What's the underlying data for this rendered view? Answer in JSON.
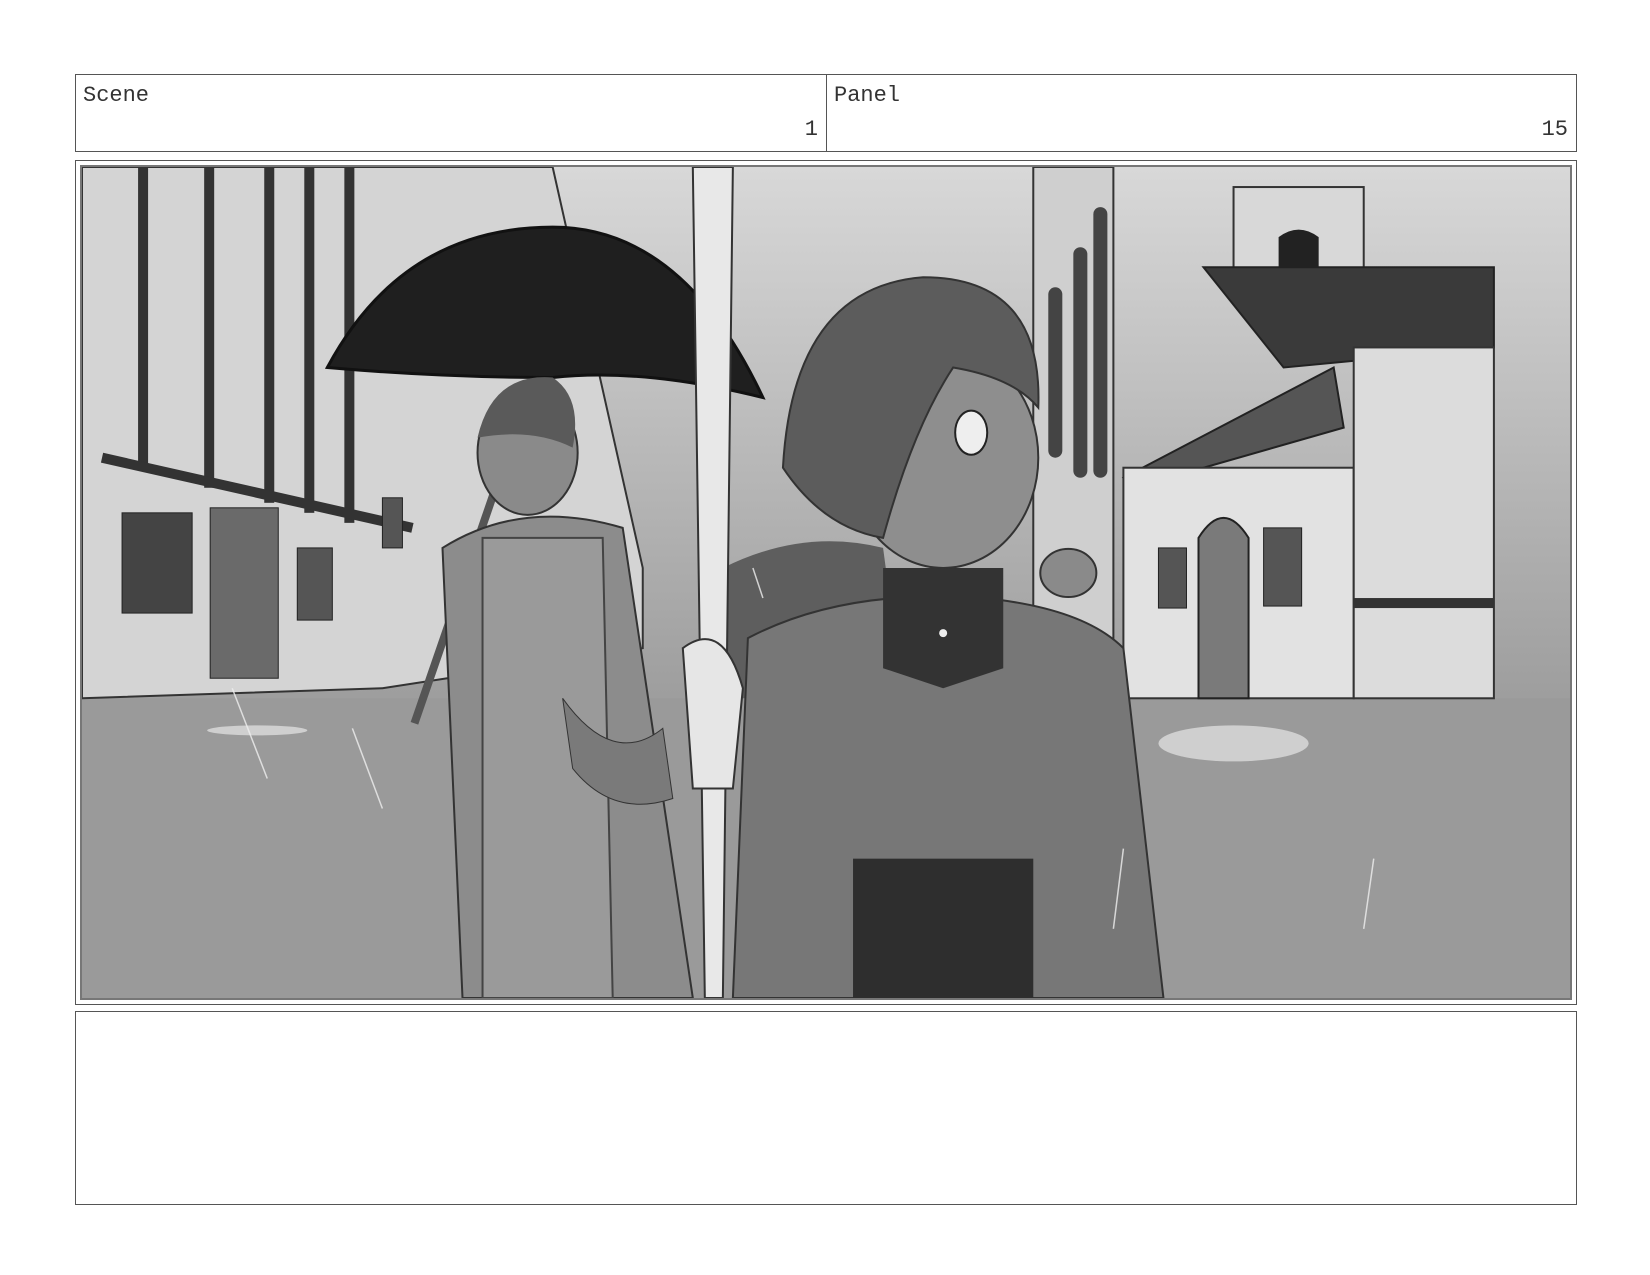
{
  "header": {
    "scene_label": "Scene",
    "scene_number": "1",
    "panel_label": "Panel",
    "panel_number": "15"
  },
  "notes": {
    "text": ""
  },
  "colors": {
    "sky": "#bdbdbd",
    "ground": "#9a9a9a",
    "dark": "#2a2a2a",
    "mid": "#6e6e6e",
    "light": "#d6d6d6"
  }
}
